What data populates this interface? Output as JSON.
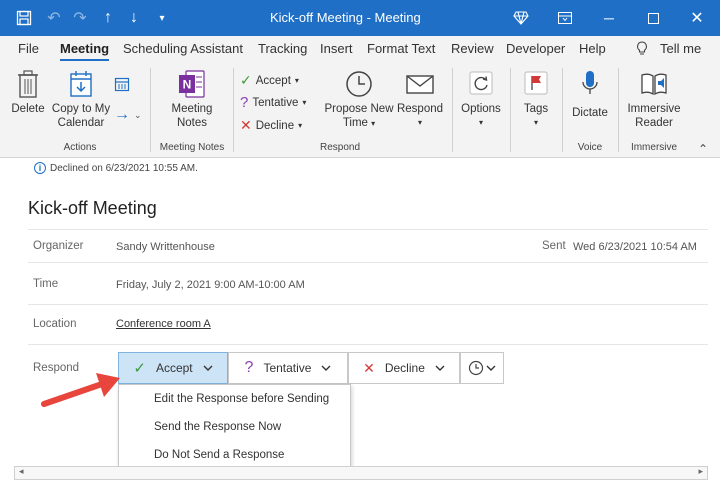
{
  "titlebar": {
    "title": "Kick-off Meeting  -  Meeting",
    "bg": "#1e6fc5"
  },
  "tabs": [
    "File",
    "Meeting",
    "Scheduling Assistant",
    "Tracking",
    "Insert",
    "Format Text",
    "Review",
    "Developer",
    "Help",
    "Tell me"
  ],
  "ribbon": {
    "delete": "Delete",
    "copy_line1": "Copy to My",
    "copy_line2": "Calendar",
    "group_actions": "Actions",
    "meeting_notes_line1": "Meeting",
    "meeting_notes_line2": "Notes",
    "group_meeting_notes": "Meeting Notes",
    "accept": "Accept",
    "tentative": "Tentative",
    "decline": "Decline",
    "propose_line1": "Propose New",
    "propose_line2": "Time",
    "respond": "Respond",
    "group_respond": "Respond",
    "options": "Options",
    "tags": "Tags",
    "dictate": "Dictate",
    "group_voice": "Voice",
    "immersive_line1": "Immersive",
    "immersive_line2": "Reader",
    "group_immersive": "Immersive"
  },
  "content": {
    "info": "Declined on 6/23/2021 10:55 AM.",
    "subject": "Kick-off Meeting",
    "organizer_label": "Organizer",
    "organizer_value": "Sandy Writtenhouse",
    "sent_label": "Sent",
    "sent_value": "Wed 6/23/2021 10:54 AM",
    "time_label": "Time",
    "time_value": "Friday, July 2, 2021 9:00 AM-10:00 AM",
    "location_label": "Location",
    "location_value": "Conference room A",
    "respond_label": "Respond"
  },
  "respond_bar": {
    "accept": "Accept",
    "tentative": "Tentative",
    "decline": "Decline"
  },
  "dropdown": {
    "items": [
      "Edit the Response before Sending",
      "Send the Response Now",
      "Do Not Send a Response"
    ]
  },
  "colors": {
    "accent": "#1e6fc5",
    "accept_green": "#3a9b3a",
    "decline_red": "#d23a3a",
    "tentative_purple": "#8a3fb5",
    "arrow_red": "#e8453c"
  }
}
